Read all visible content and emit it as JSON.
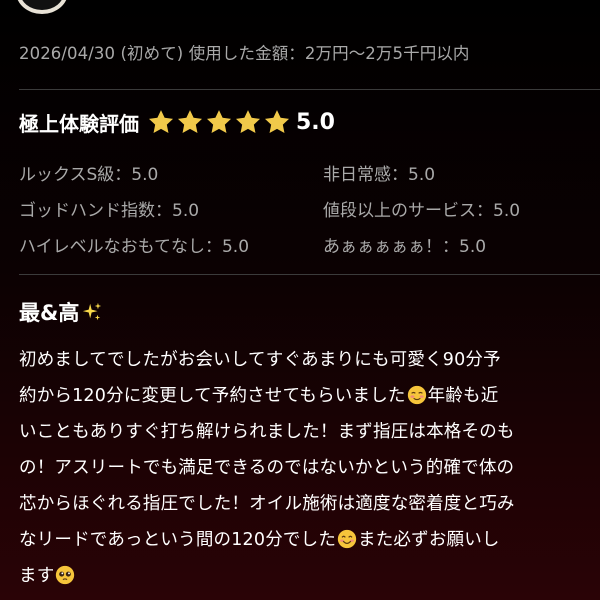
{
  "meta": {
    "date": "2026/04/30",
    "visit_type": "(初めて)",
    "amount_label": "使用した金額：",
    "amount_value": "2万円〜2万5千円以内"
  },
  "rating": {
    "title": "極上体験評価",
    "score": "5.0",
    "stars": 5,
    "star_color": "#f1c94a"
  },
  "sub_ratings": [
    {
      "label": "ルックスS級",
      "value": "5.0"
    },
    {
      "label": "非日常感",
      "value": "5.0"
    },
    {
      "label": "ゴッドハンド指数",
      "value": "5.0"
    },
    {
      "label": "値段以上のサービス",
      "value": "5.0"
    },
    {
      "label": "ハイレベルなおもてなし",
      "value": "5.0"
    },
    {
      "label": "あぁぁぁぁぁ！",
      "value": "5.0"
    }
  ],
  "separator": "：",
  "review": {
    "title": "最&高",
    "lines": [
      {
        "a": "初めましてでしたがお会いしてすぐあまりにも可愛く90分予"
      },
      {
        "a": "約から120分に変更して予約させてもらいました",
        "emoji": "relieved-face-icon",
        "b": "年齢も近"
      },
      {
        "a": "いこともありすぐ打ち解けられました！まず指圧は本格そのも"
      },
      {
        "a": "の！アスリートでも満足できるのではないかという的確で体の"
      },
      {
        "a": "芯からほぐれる指圧でした！オイル施術は適度な密着度と巧み"
      },
      {
        "a": "なリードであっという間の120分でした",
        "emoji": "smiling-face-icon",
        "b": "また必ずお願いし"
      },
      {
        "a": "ます",
        "emoji": "pleading-face-icon",
        "b": ""
      }
    ]
  }
}
